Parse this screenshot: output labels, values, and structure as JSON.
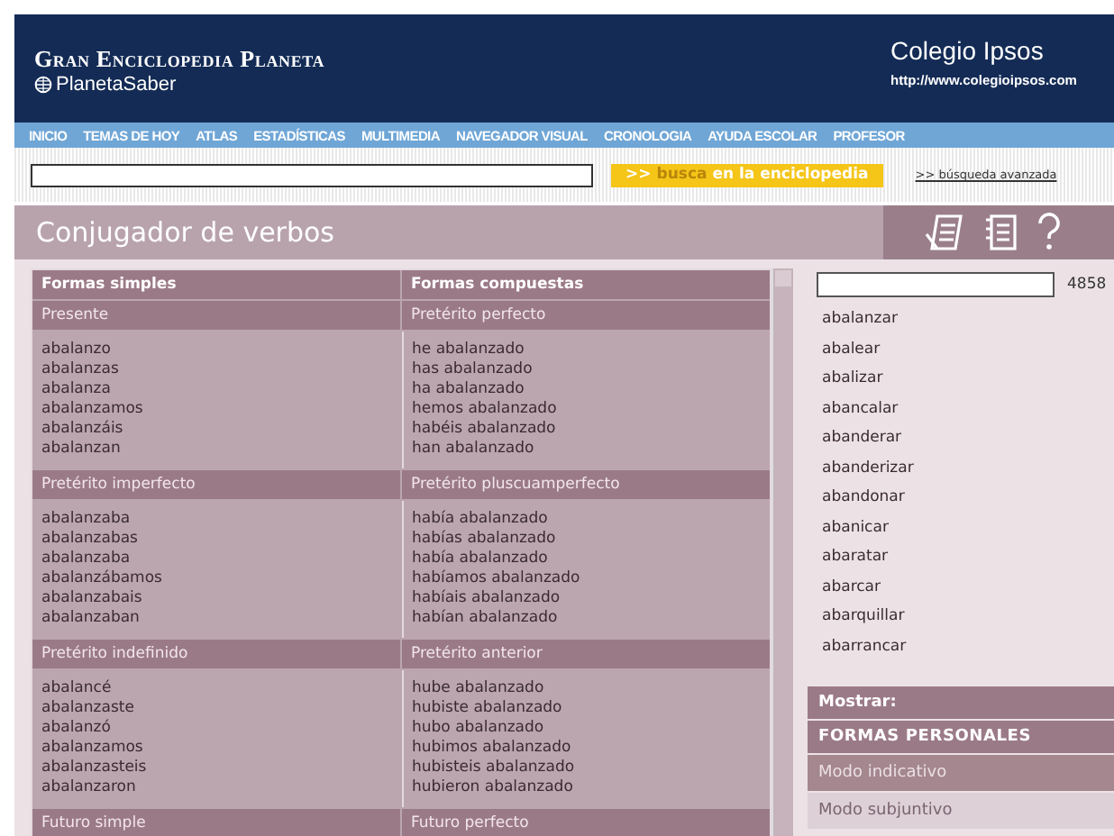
{
  "header": {
    "title": "Gran Enciclopedia Planeta",
    "brand": "PlanetaSaber",
    "school": "Colegio Ipsos",
    "url": "http://www.colegioipsos.com"
  },
  "nav": [
    "INICIO",
    "TEMAS DE HOY",
    "ATLAS",
    "ESTADÍSTICAS",
    "MULTIMEDIA",
    "NAVEGADOR VISUAL",
    "CRONOLOGIA",
    "AYUDA ESCOLAR",
    "PROFESOR"
  ],
  "search": {
    "button_icon": ">>",
    "button_strong": "busca",
    "button_rest": "en la enciclopedia",
    "advanced": ">> búsqueda avanzada"
  },
  "page_title": "Conjugador de verbos",
  "table": {
    "columns": [
      "Formas simples",
      "Formas compuestas"
    ],
    "sections": [
      {
        "simple": {
          "tense": "Presente",
          "forms": [
            "abalanzo",
            "abalanzas",
            "abalanza",
            "abalanzamos",
            "abalanzáis",
            "abalanzan"
          ]
        },
        "compound": {
          "tense": "Pretérito perfecto",
          "forms": [
            "he abalanzado",
            "has abalanzado",
            "ha abalanzado",
            "hemos abalanzado",
            "habéis abalanzado",
            "han abalanzado"
          ]
        }
      },
      {
        "simple": {
          "tense": "Pretérito imperfecto",
          "forms": [
            "abalanzaba",
            "abalanzabas",
            "abalanzaba",
            "abalanzábamos",
            "abalanzabais",
            "abalanzaban"
          ]
        },
        "compound": {
          "tense": "Pretérito pluscuamperfecto",
          "forms": [
            "había abalanzado",
            "habías abalanzado",
            "había abalanzado",
            "habíamos abalanzado",
            "habíais abalanzado",
            "habían abalanzado"
          ]
        }
      },
      {
        "simple": {
          "tense": "Pretérito indefinido",
          "forms": [
            "abalancé",
            "abalanzaste",
            "abalanzó",
            "abalanzamos",
            "abalanzasteis",
            "abalanzaron"
          ]
        },
        "compound": {
          "tense": "Pretérito anterior",
          "forms": [
            "hube abalanzado",
            "hubiste abalanzado",
            "hubo abalanzado",
            "hubimos abalanzado",
            "hubisteis abalanzado",
            "hubieron abalanzado"
          ]
        }
      },
      {
        "simple": {
          "tense": "Futuro simple"
        },
        "compound": {
          "tense": "Futuro perfecto"
        }
      }
    ]
  },
  "verb_search": {
    "count": "4858"
  },
  "verbs": [
    "abalanzar",
    "abalear",
    "abalizar",
    "abancalar",
    "abanderar",
    "abanderizar",
    "abandonar",
    "abanicar",
    "abaratar",
    "abarcar",
    "abarquillar",
    "abarrancar"
  ],
  "show": {
    "label": "Mostrar:",
    "group": "FORMAS PERSONALES",
    "modes": [
      {
        "label": "Modo indicativo",
        "selected": true
      },
      {
        "label": "Modo subjuntivo",
        "selected": false
      }
    ]
  }
}
